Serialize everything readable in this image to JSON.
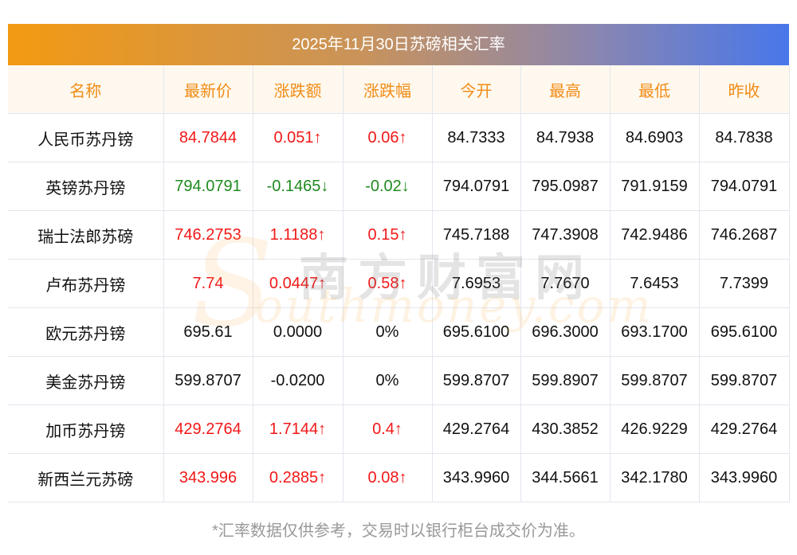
{
  "title": "2025年11月30日苏磅相关汇率",
  "headers": [
    "名称",
    "最新价",
    "涨跌额",
    "涨跌幅",
    "今开",
    "最高",
    "最低",
    "昨收"
  ],
  "rows": [
    {
      "trend": "up",
      "cells": [
        "人民币苏丹镑",
        "84.7844",
        "0.051↑",
        "0.06↑",
        "84.7333",
        "84.7938",
        "84.6903",
        "84.7838"
      ]
    },
    {
      "trend": "down",
      "cells": [
        "英镑苏丹镑",
        "794.0791",
        "-0.1465↓",
        "-0.02↓",
        "794.0791",
        "795.0987",
        "791.9159",
        "794.0791"
      ]
    },
    {
      "trend": "up",
      "cells": [
        "瑞士法郎苏磅",
        "746.2753",
        "1.1188↑",
        "0.15↑",
        "745.7188",
        "747.3908",
        "742.9486",
        "746.2687"
      ]
    },
    {
      "trend": "up",
      "cells": [
        "卢布苏丹镑",
        "7.74",
        "0.0447↑",
        "0.58↑",
        "7.6953",
        "7.7670",
        "7.6453",
        "7.7399"
      ]
    },
    {
      "trend": "flat",
      "cells": [
        "欧元苏丹镑",
        "695.61",
        "0.0000",
        "0%",
        "695.6100",
        "696.3000",
        "693.1700",
        "695.6100"
      ]
    },
    {
      "trend": "flat",
      "cells": [
        "美金苏丹镑",
        "599.8707",
        "-0.0200",
        "0%",
        "599.8707",
        "599.8907",
        "599.8707",
        "599.8707"
      ]
    },
    {
      "trend": "up",
      "cells": [
        "加币苏丹镑",
        "429.2764",
        "1.7144↑",
        "0.4↑",
        "429.2764",
        "430.3852",
        "426.9229",
        "429.2764"
      ]
    },
    {
      "trend": "up",
      "cells": [
        "新西兰元苏磅",
        "343.996",
        "0.2885↑",
        "0.08↑",
        "343.9960",
        "344.5661",
        "342.1780",
        "343.9960"
      ]
    }
  ],
  "watermark": {
    "cn": "南方财富网",
    "en": "outhmoney.com",
    "s": "S"
  },
  "footnote": "*汇率数据仅供参考，交易时以银行柜台成交价为准。",
  "colors": {
    "up": "#f21818",
    "down": "#1f8a1f",
    "header": "#f08c16"
  }
}
